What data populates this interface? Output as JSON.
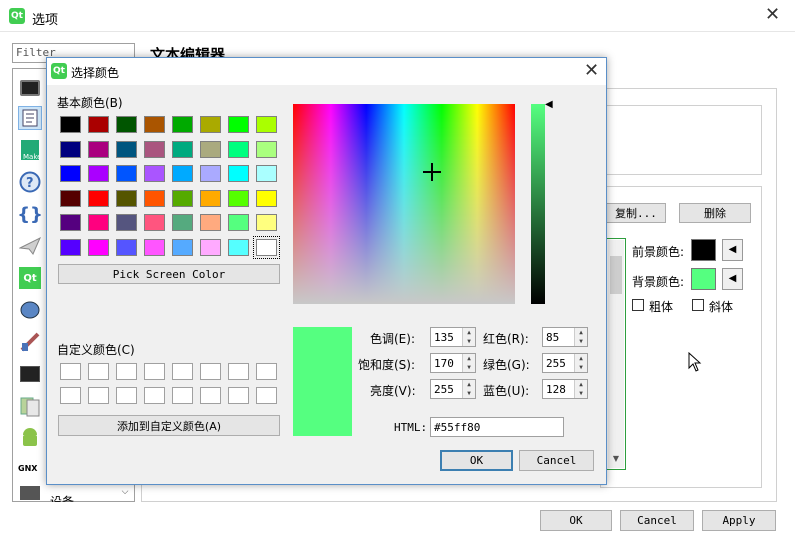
{
  "options_window": {
    "title": "选项",
    "filter_placeholder": "Filter",
    "section_title": "文本编辑器",
    "copy_button": "复制...",
    "delete_button": "删除",
    "foreground_label": "前景颜色:",
    "background_label": "背景颜色:",
    "bold_label": "粗体",
    "italic_label": "斜体",
    "ok_button": "OK",
    "cancel_button": "Cancel",
    "apply_button": "Apply",
    "sidebar_partial_label": "设备",
    "sidebar_gnx_label": "GNX",
    "foreground_color": "#000000",
    "background_color": "#55ff80"
  },
  "color_dialog": {
    "title": "选择颜色",
    "basic_colors_label": "基本颜色(B)",
    "basic_colors": [
      "#000000",
      "#aa0000",
      "#005500",
      "#aa5500",
      "#00aa00",
      "#aaaa00",
      "#00ff00",
      "#aaff00",
      "#00007f",
      "#aa007f",
      "#00557f",
      "#aa557f",
      "#00aa7f",
      "#aaaa7f",
      "#00ff7f",
      "#aaff7f",
      "#0000ff",
      "#aa00ff",
      "#0055ff",
      "#aa55ff",
      "#00aaff",
      "#aaaaff",
      "#00ffff",
      "#aaffff",
      "#550000",
      "#ff0000",
      "#555500",
      "#ff5500",
      "#55aa00",
      "#ffaa00",
      "#55ff00",
      "#ffff00",
      "#55007f",
      "#ff007f",
      "#55557f",
      "#ff557f",
      "#55aa7f",
      "#ffaa7f",
      "#55ff7f",
      "#ffff7f",
      "#5500ff",
      "#ff00ff",
      "#5555ff",
      "#ff55ff",
      "#55aaff",
      "#ffaaff",
      "#55ffff",
      "#ffffff"
    ],
    "pick_screen_color": "Pick Screen Color",
    "custom_colors_label": "自定义颜色(C)",
    "add_custom_button": "添加到自定义颜色(A)",
    "current_color": "#55ff80",
    "hue_label": "色调(E):",
    "hue_value": "135",
    "sat_label": "饱和度(S):",
    "sat_value": "170",
    "val_label": "亮度(V):",
    "val_value": "255",
    "red_label": "红色(R):",
    "red_value": "85",
    "green_label": "绿色(G):",
    "green_value": "255",
    "blue_label": "蓝色(U):",
    "blue_value": "128",
    "html_label": "HTML:",
    "html_value": "#55ff80",
    "ok_button": "OK",
    "cancel_button": "Cancel"
  }
}
